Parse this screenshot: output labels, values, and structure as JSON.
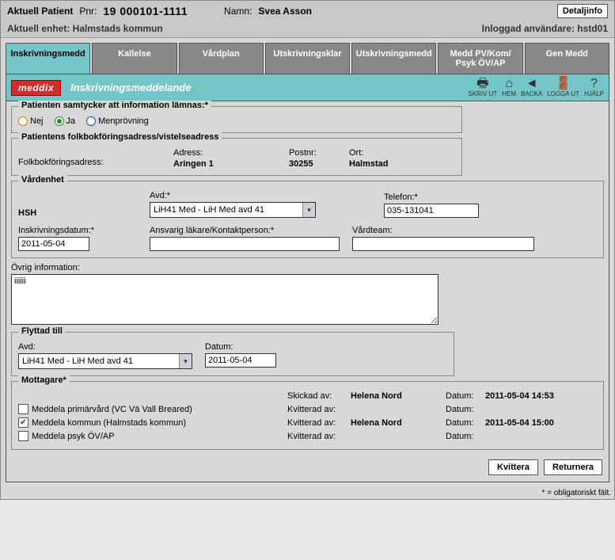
{
  "header": {
    "aktuell_patient": "Aktuell Patient",
    "pnr_label": "Pnr:",
    "pnr": "19 000101-1111",
    "namn_label": "Namn:",
    "namn": "Svea Asson",
    "detalj_btn": "Detaljinfo",
    "aktuell_enhet": "Aktuell enhet: Halmstads kommun",
    "inloggad": "Inloggad användare: hstd01"
  },
  "tabs": [
    "Inskrivningsmedd",
    "Kallelse",
    "Vårdplan",
    "Utskrivningsklar",
    "Utskrivningsmedd",
    "Medd PV/Kom/ Psyk ÖV/AP",
    "Gen Medd"
  ],
  "section": {
    "logo": "meddix",
    "title": "Inskrivningsmeddelande",
    "icons": {
      "skriv_ut": "SKRIV UT",
      "hem": "HEM",
      "backa": "BACKA",
      "logga_ut": "LOGGA UT",
      "hjalp": "HJÄLP"
    }
  },
  "samtyck": {
    "legend": "Patienten samtycker att information lämnas:*",
    "opts": {
      "nej": "Nej",
      "ja": "Ja",
      "men": "Menprövning"
    }
  },
  "adress": {
    "legend": "Patientens folkbokföringsadress/vistelseadress",
    "folk_lbl": "Folkbokföringsadress:",
    "adr_lbl": "Adress:",
    "adr": "Aringen 1",
    "postnr_lbl": "Postnr:",
    "postnr": "30255",
    "ort_lbl": "Ort:",
    "ort": "Halmstad"
  },
  "vard": {
    "legend": "Vårdenhet",
    "hsh": "HSH",
    "avd_lbl": "Avd:*",
    "avd": "LiH41 Med - LiH Med avd 41",
    "tel_lbl": "Telefon:*",
    "tel": "035-131041",
    "inskr_lbl": "Inskrivningsdatum:*",
    "inskr": "2011-05-04",
    "ansv_lbl": "Ansvarig läkare/Kontaktperson:*",
    "ansv": "",
    "team_lbl": "Vårdteam:",
    "team": ""
  },
  "ovrig": {
    "lbl": "Övrig information:",
    "text": "iiiiii"
  },
  "flyttad": {
    "legend": "Flyttad till",
    "avd_lbl": "Avd:",
    "avd": "LiH41 Med - LiH Med avd 41",
    "dat_lbl": "Datum:",
    "dat": "2011-05-04"
  },
  "mottag": {
    "legend": "Mottagare*",
    "skickad_lbl": "Skickad av:",
    "skickad_by": "Helena Nord",
    "skickad_dat_lbl": "Datum:",
    "skickad_dat": "2011-05-04 14:53",
    "rows": [
      {
        "chk": false,
        "lbl": "Meddela primärvård",
        "paren": "(VC Vä Vall Breared)",
        "kv_lbl": "Kvitterad av:",
        "kv_by": "",
        "dat_lbl": "Datum:",
        "dat": ""
      },
      {
        "chk": true,
        "lbl": "Meddela kommun",
        "paren": "(Halmstads kommun)",
        "kv_lbl": "Kvitterad av:",
        "kv_by": "Helena Nord",
        "dat_lbl": "Datum:",
        "dat": "2011-05-04 15:00"
      },
      {
        "chk": false,
        "lbl": "Meddela psyk ÖV/AP",
        "paren": "",
        "kv_lbl": "Kvitterad av:",
        "kv_by": "",
        "dat_lbl": "Datum:",
        "dat": ""
      }
    ]
  },
  "footer": {
    "kvit": "Kvittera",
    "ret": "Returnera"
  },
  "oblig": "* = obligatoriskt fält."
}
